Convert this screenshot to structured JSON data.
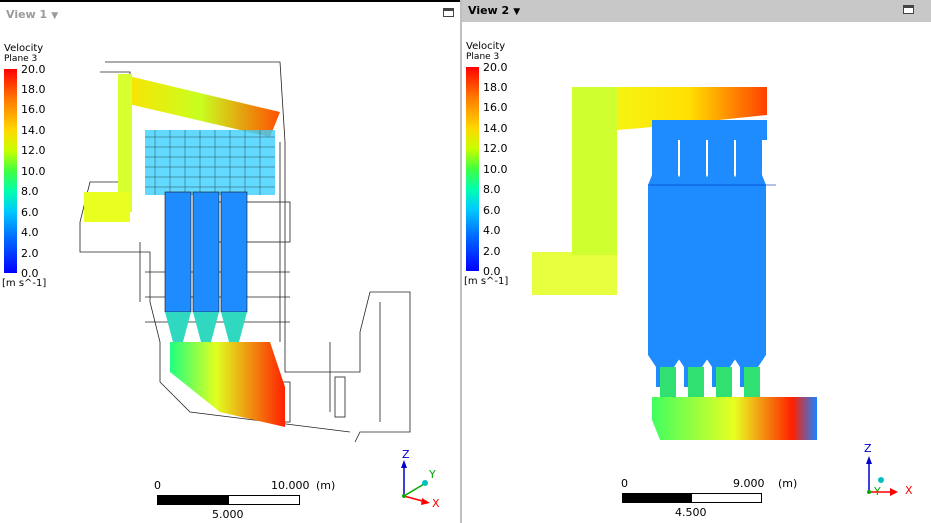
{
  "view1": {
    "title": "View 1",
    "caret": "▼",
    "legend": {
      "variable": "Velocity",
      "location": "Plane 3",
      "ticks": [
        "20.0",
        "18.0",
        "16.0",
        "14.0",
        "12.0",
        "10.0",
        "8.0",
        "6.0",
        "4.0",
        "2.0",
        "0.0"
      ],
      "units": "[m s^-1]"
    },
    "scale": {
      "start": "0",
      "end": "10.000",
      "unit": "(m)",
      "mid": "5.000"
    },
    "axes": {
      "z": "Z",
      "y": "Y",
      "x": "X"
    }
  },
  "view2": {
    "title": "View 2",
    "caret": "▼",
    "legend": {
      "variable": "Velocity",
      "location": "Plane 3",
      "ticks": [
        "20.0",
        "18.0",
        "16.0",
        "14.0",
        "12.0",
        "10.0",
        "8.0",
        "6.0",
        "4.0",
        "2.0",
        "0.0"
      ],
      "units": "[m s^-1]"
    },
    "scale": {
      "start": "0",
      "end": "9.000",
      "unit": "(m)",
      "mid": "4.500"
    },
    "axes": {
      "z": "Z",
      "y": "Y",
      "x": "X"
    }
  },
  "colors": {
    "axis_z": "#0000cc",
    "axis_y": "#00aa00",
    "axis_x": "#ff0000",
    "flow_core": "#1e90ff",
    "flow_high": "#ff2a00",
    "flow_mid": "#d6ff2a"
  }
}
